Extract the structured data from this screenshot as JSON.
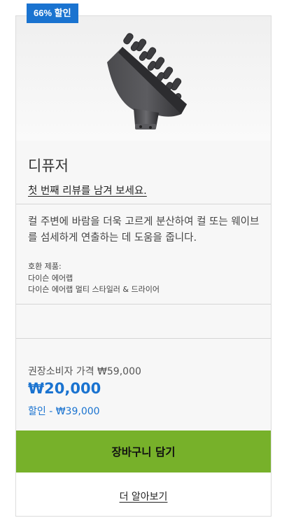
{
  "badge": {
    "label": "66% 할인"
  },
  "product": {
    "image_icon": "diffuser-product-image",
    "title": "디퓨저",
    "review_link": "첫 번째 리뷰를 남겨 보세요.",
    "description": "컬 주변에 바람을 더욱 고르게 분산하여 컬 또는 웨이브를 섬세하게 연출하는 데 도움을 줍니다.",
    "compat_heading": "호환 제품:",
    "compat_items": [
      "다이슨 에어랩",
      "다이슨 에어랩 멀티 스타일러 & 드라이어"
    ]
  },
  "pricing": {
    "rrp": "권장소비자 가격 ₩59,000",
    "price": "₩20,000",
    "discount": "할인 - ₩39,000"
  },
  "actions": {
    "add_to_cart": "장바구니 담기",
    "learn_more": "더 알아보기"
  },
  "colors": {
    "accent": "#1a73d0",
    "cart": "#77b12a"
  }
}
